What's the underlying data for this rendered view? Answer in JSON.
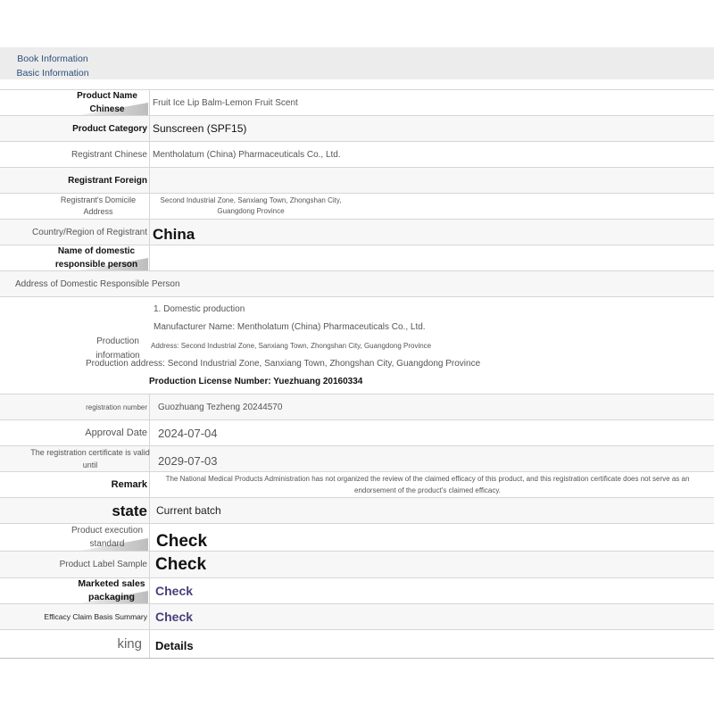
{
  "header": {
    "title": "Book Information Basic Information"
  },
  "rows": {
    "product_name": {
      "label": "Product Name Chinese",
      "value": "Fruit Ice Lip Balm-Lemon Fruit Scent"
    },
    "product_category": {
      "label": "Product Category",
      "value": "Sunscreen (SPF15)"
    },
    "registrant_chinese": {
      "label": "Registrant Chinese",
      "value": "Mentholatum (China) Pharmaceuticals Co., Ltd."
    },
    "registrant_foreign": {
      "label": "Registrant Foreign",
      "value": ""
    },
    "registrant_domicile": {
      "label": "Registrant's Domicile Address",
      "value": "Second Industrial Zone, Sanxiang Town, Zhongshan City, Guangdong Province"
    },
    "country": {
      "label": "Country/Region of Registrant",
      "value": "China"
    },
    "domestic_person": {
      "label": "Name of domestic responsible person",
      "value": ""
    },
    "domestic_address": {
      "label": "Address of Domestic Responsible Person",
      "value": ""
    },
    "production": {
      "label": "Production information",
      "line1": "1. Domestic production",
      "line2": "Manufacturer Name: Mentholatum (China) Pharmaceuticals Co., Ltd.",
      "line3": "Address: Second Industrial Zone, Sanxiang Town, Zhongshan City, Guangdong Province",
      "line4": "Production address: Second Industrial Zone, Sanxiang Town, Zhongshan City, Guangdong Province",
      "line5": "Production License Number: Yuezhuang 20160334"
    },
    "registration_number": {
      "label": "registration number",
      "value": "Guozhuang Tezheng 20244570"
    },
    "approval_date": {
      "label": "Approval Date",
      "value": "2024-07-04"
    },
    "valid_until": {
      "label": "The registration certificate is valid until",
      "value": "2029-07-03"
    },
    "remark": {
      "label": "Remark",
      "value": "The National Medical Products Administration has not organized the review of the claimed efficacy of this product, and this registration certificate does not serve as an endorsement of the product's claimed efficacy."
    },
    "state": {
      "label": "state",
      "value": "Current batch"
    },
    "execution_standard": {
      "label": "Product execution standard",
      "value": "Check"
    },
    "label_sample": {
      "label": "Product Label Sample",
      "value": "Check"
    },
    "sales_packaging": {
      "label": "Marketed sales packaging",
      "value": "Check"
    },
    "efficacy_summary": {
      "label": "Efficacy Claim Basis Summary",
      "value": "Check"
    },
    "king": {
      "label": "king",
      "value": "Details"
    }
  }
}
